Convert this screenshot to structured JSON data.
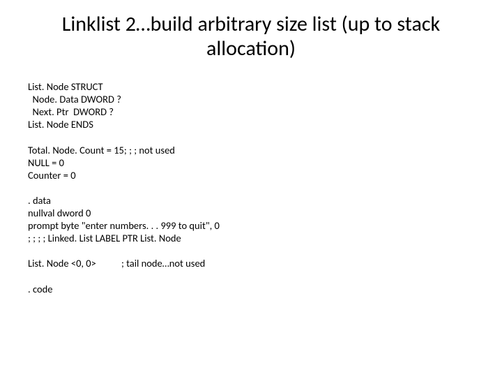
{
  "title": "Linklist 2…build arbitrary size list (up to stack allocation)",
  "blocks": {
    "struct": "List. Node STRUCT\n  Node. Data DWORD ?\n  Next. Ptr  DWORD ?\nList. Node ENDS",
    "consts": "Total. Node. Count = 15; ; ; not used\nNULL = 0\nCounter = 0",
    "data": ". data\nnullval dword 0\nprompt byte \"enter numbers. . . 999 to quit\", 0\n; ; ; ; Linked. List LABEL PTR List. Node",
    "tail": "List. Node <0, 0>           ; tail node…not used",
    "code": ". code"
  }
}
